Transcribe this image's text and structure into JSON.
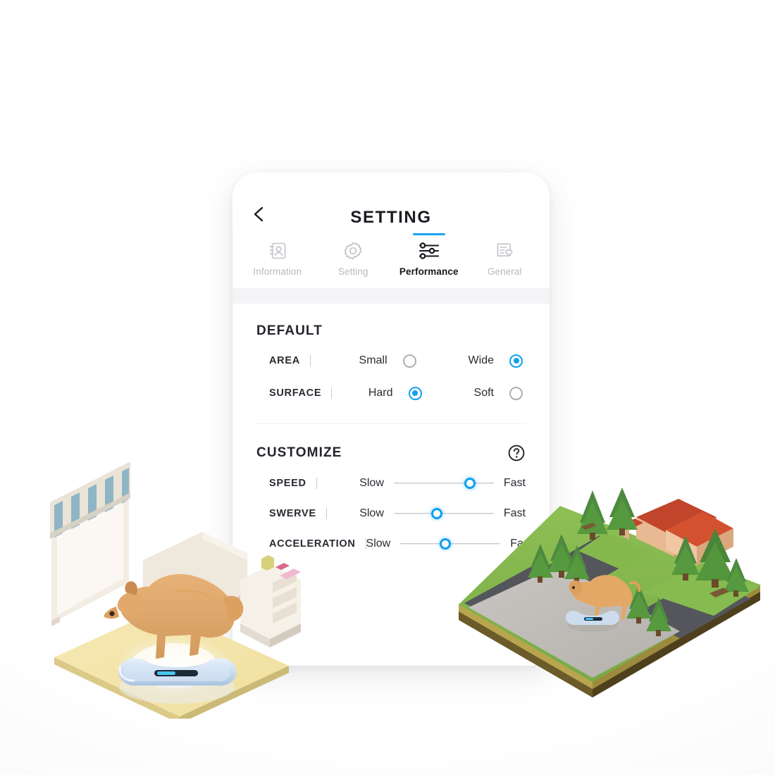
{
  "app": {
    "screen_title": "SETTING",
    "back_icon": "chevron-left-icon"
  },
  "tabs": [
    {
      "label": "Information",
      "icon": "contact-card-icon",
      "active": false
    },
    {
      "label": "Setting",
      "icon": "gear-icon",
      "active": false
    },
    {
      "label": "Performance",
      "icon": "sliders-icon",
      "active": true
    },
    {
      "label": "General",
      "icon": "checklist-heart-icon",
      "active": false
    }
  ],
  "default_section": {
    "title": "DEFAULT",
    "rows": [
      {
        "key": "AREA",
        "options": [
          {
            "label": "Small",
            "selected": false
          },
          {
            "label": "Wide",
            "selected": true
          }
        ]
      },
      {
        "key": "SURFACE",
        "options": [
          {
            "label": "Hard",
            "selected": true
          },
          {
            "label": "Soft",
            "selected": false
          }
        ]
      }
    ]
  },
  "customize_section": {
    "title": "CUSTOMIZE",
    "help_icon": "question-mark-circle-icon",
    "sliders": [
      {
        "key": "SPEED",
        "min_label": "Slow",
        "max_label": "Fast",
        "value_pct": 76
      },
      {
        "key": "SWERVE",
        "min_label": "Slow",
        "max_label": "Fast",
        "value_pct": 43
      },
      {
        "key": "ACCELERATION",
        "min_label": "Slow",
        "max_label": "Fast",
        "value_pct": 45
      }
    ]
  },
  "colors": {
    "accent_blue": "#0fa0ee",
    "tab_active_underline": "#1aa3ef",
    "text_primary": "#24242c",
    "text_muted": "#b9b9bf",
    "divider": "#efeff2",
    "panel_bg": "#ffffff",
    "tab_separator_band": "#f4f4f6"
  },
  "illustrations": {
    "left": {
      "name": "indoor-scene-dog-with-bone-robot",
      "elements": [
        "window-with-striped-awning",
        "golden-retriever-dog",
        "nightstand",
        "cream-rug",
        "bone-shaped-robot-toy"
      ]
    },
    "right": {
      "name": "outdoor-diorama-dog-with-bone-robot",
      "elements": [
        "concrete-lot",
        "asphalt-roads",
        "grass",
        "pine-trees",
        "house-with-orange-roof",
        "golden-retriever-dog",
        "bone-shaped-robot-toy"
      ]
    }
  }
}
